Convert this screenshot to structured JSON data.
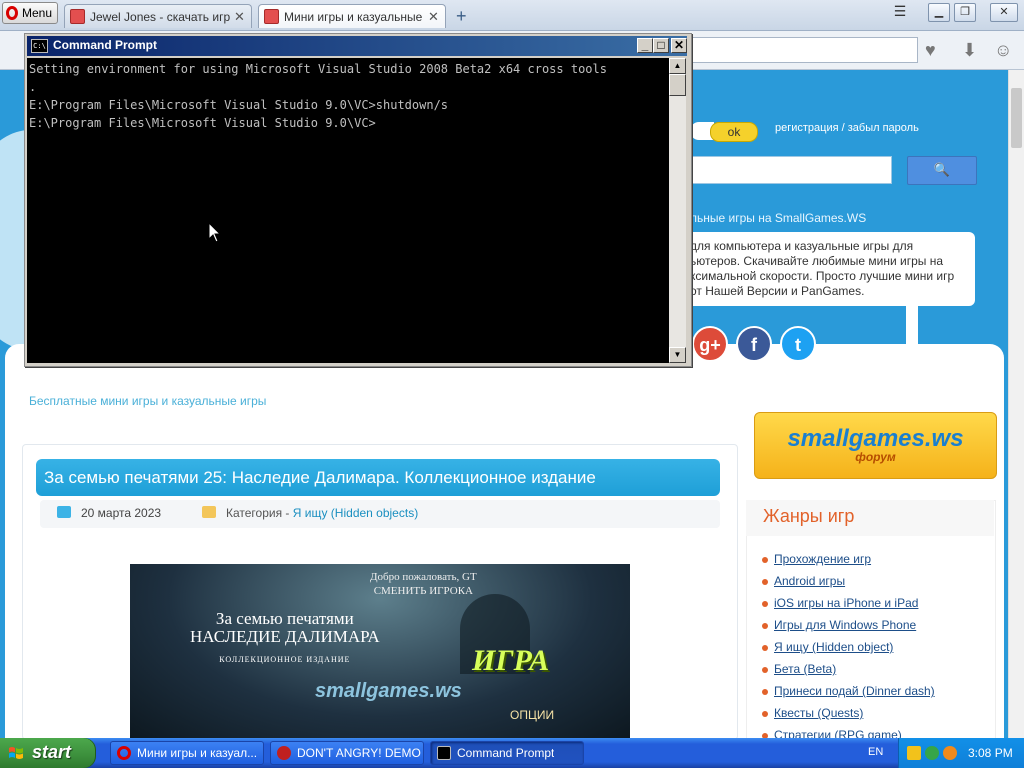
{
  "browser": {
    "menu_label": "Menu",
    "tabs": [
      {
        "label": "Jewel Jones - скачать игру"
      },
      {
        "label": "Мини игры и казуальные иг"
      }
    ],
    "new_tab_icon": "plus-icon"
  },
  "page": {
    "ok_label": "ok",
    "reg_link": "регистрация / забыл пароль",
    "slogan": "льные игры на SmallGames.WS",
    "description": "для компьютера и казуальные игры для ьютеров. Скачивайте любимые мини игры на ксимальной скорости. Просто лучшие мини игр от Нашей Версии и PanGames.",
    "social": [
      {
        "name": "google-plus",
        "label": "g+",
        "color": "#dd4b39"
      },
      {
        "name": "facebook",
        "label": "f",
        "color": "#3b5998"
      },
      {
        "name": "twitter",
        "label": "t",
        "color": "#1da1f2"
      }
    ],
    "free_games": "Бесплатные мини игры и казуальные игры",
    "article": {
      "title": "За семью печатями 25: Наследие Далимара. Коллекционное издание",
      "date": "20 марта 2023",
      "category_prefix": "Категория - ",
      "category": "Я ищу (Hidden objects)",
      "image": {
        "title_line1": "За семью печатями",
        "title_line2": "НАСЛЕДИЕ ДАЛИМАРА",
        "edition": "КОЛЛЕКЦИОННОЕ ИЗДАНИЕ",
        "welcome_line1": "Добро пожаловать, GT",
        "welcome_line2": "СМЕНИТЬ ИГРОКА",
        "igra": "ИГРА",
        "watermark": "smallgames.ws",
        "options": "ОПЦИИ"
      }
    },
    "forum_banner": {
      "logo": "smallgames.ws",
      "sub": "форум"
    },
    "genres": {
      "title": "Жанры игр",
      "items": [
        "Прохождение игр",
        "Android игры",
        "iOS игры на iPhone и iPad",
        "Игры для Windows Phone",
        "Я ищу (Hidden object)",
        "Бета (Beta)",
        "Принеси подай (Dinner dash)",
        "Квесты (Quests)",
        "Стратегии (RPG game)"
      ]
    }
  },
  "cmd": {
    "title": "Command Prompt",
    "lines": [
      "Setting environment for using Microsoft Visual Studio 2008 Beta2 x64 cross tools",
      ".",
      "",
      "E:\\Program Files\\Microsoft Visual Studio 9.0\\VC>shutdown/s",
      "",
      "E:\\Program Files\\Microsoft Visual Studio 9.0\\VC>"
    ]
  },
  "taskbar": {
    "start_label": "start",
    "tasks": [
      {
        "label": "Мини игры и казуал...",
        "icon": "opera-icon"
      },
      {
        "label": "DON'T ANGRY! DEMO",
        "icon": "game-icon"
      },
      {
        "label": "Command Prompt",
        "icon": "cmd-icon"
      }
    ],
    "lang": "EN",
    "clock": "3:08 PM"
  }
}
